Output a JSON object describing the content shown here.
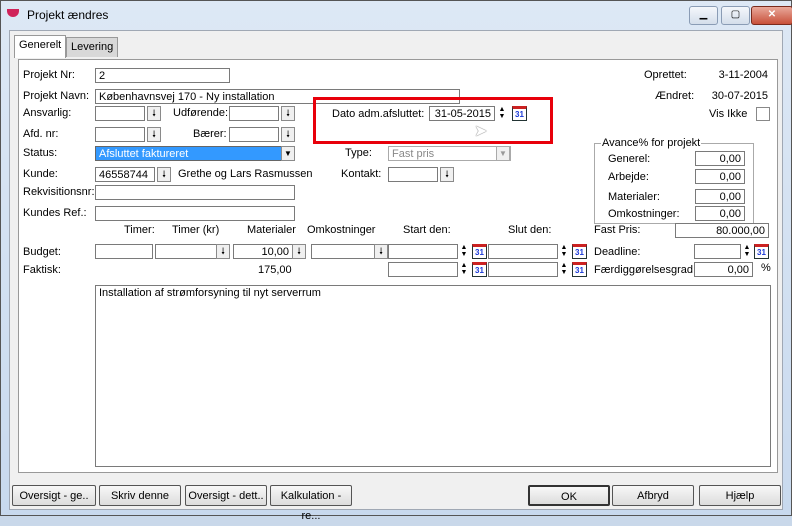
{
  "window": {
    "title": "Projekt ændres",
    "minimize": "▁",
    "maximize": "▢",
    "close": "✕"
  },
  "tabs": [
    "Generelt",
    "Levering"
  ],
  "form": {
    "projekt_nr_label": "Projekt Nr:",
    "projekt_nr": "2",
    "projekt_navn_label": "Projekt Navn:",
    "projekt_navn": "Københavnsvej 170 - Ny installation",
    "ansvarlig_label": "Ansvarlig:",
    "udforende_label": "Udførende:",
    "afd_label": "Afd. nr:",
    "baerer_label": "Bærer:",
    "status_label": "Status:",
    "status": "Afsluttet faktureret",
    "type_label": "Type:",
    "type": "Fast pris",
    "kunde_label": "Kunde:",
    "kunde_nr": "46558744",
    "kunde_navn": "Grethe og Lars Rasmussen",
    "kontakt_label": "Kontakt:",
    "rekv_label": "Rekvisitionsnr:",
    "kundes_ref_label": "Kundes Ref.:",
    "dato_label": "Dato adm.afsluttet:",
    "dato": "31-05-2015",
    "oprettet_label": "Oprettet:",
    "oprettet": "3-11-2004",
    "aendret_label": "Ændret:",
    "aendret": "30-07-2015",
    "vis_ikke_label": "Vis Ikke"
  },
  "avance": {
    "title": "Avance% for projekt",
    "rows": [
      {
        "label": "Generel:",
        "value": "0,00"
      },
      {
        "label": "Arbejde:",
        "value": "0,00"
      },
      {
        "label": "Materialer:",
        "value": "0,00"
      },
      {
        "label": "Omkostninger:",
        "value": "0,00"
      }
    ]
  },
  "grid": {
    "headers": [
      "Timer:",
      "Timer (kr)",
      "Materialer",
      "Omkostninger",
      "Start den:",
      "Slut den:"
    ],
    "budget_label": "Budget:",
    "budget_materialer": "10,00",
    "faktisk_label": "Faktisk:",
    "faktisk_materialer": "175,00"
  },
  "right": {
    "fast_pris_label": "Fast Pris:",
    "fast_pris": "80.000,00",
    "deadline_label": "Deadline:",
    "faerdig_label": "Færdiggørelsesgrad:",
    "faerdig": "0,00",
    "pct": "%"
  },
  "description": "Installation af strømforsyning til nyt serverrum",
  "buttons": [
    "Oversigt - ge..",
    "Skriv denne",
    "Oversigt - dett..",
    "Kalkulation - re...",
    "OK",
    "Afbryd",
    "Hjælp"
  ],
  "icons": {
    "down": "🠗",
    "updown": "▲▼",
    "cal": "31"
  }
}
